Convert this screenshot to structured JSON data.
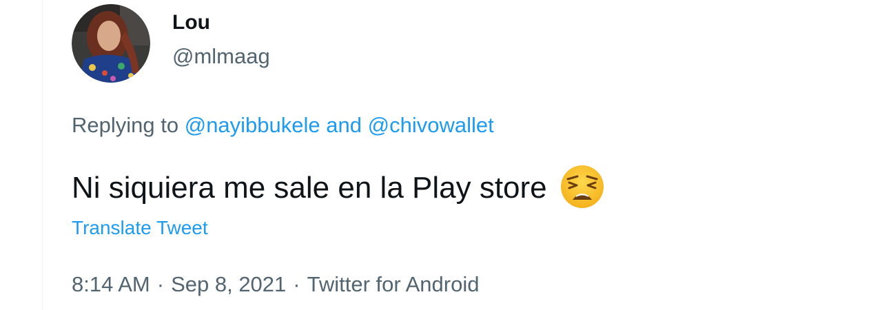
{
  "author": {
    "display_name": "Lou",
    "handle": "@mlmaag"
  },
  "reply": {
    "prefix": "Replying to",
    "mention_1": "@nayibbukele",
    "conjunction": "and",
    "mention_2": "@chivowallet"
  },
  "tweet": {
    "text": "Ni siquiera me sale en la Play store",
    "emoji_icon": "weary-face-emoji",
    "translate_label": "Translate Tweet"
  },
  "meta": {
    "time": "8:14 AM",
    "separator": "·",
    "date": "Sep 8, 2021",
    "source": "Twitter for Android"
  },
  "colors": {
    "link": "#1d9bf0",
    "secondary_text": "#536471",
    "primary_text": "#0f1419"
  }
}
